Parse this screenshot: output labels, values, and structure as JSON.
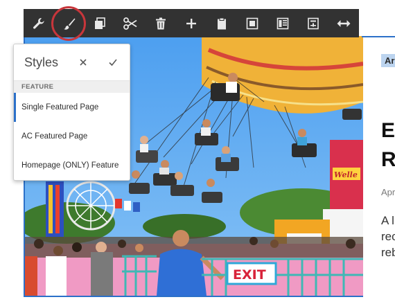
{
  "toolbar": {
    "buttons": [
      {
        "id": "configure",
        "icon": "wrench-icon"
      },
      {
        "id": "styles",
        "icon": "paintbrush-icon",
        "highlighted": true
      },
      {
        "id": "copy",
        "icon": "copy-icon"
      },
      {
        "id": "cut",
        "icon": "scissors-icon"
      },
      {
        "id": "delete",
        "icon": "trash-icon"
      },
      {
        "id": "insert",
        "icon": "plus-icon"
      },
      {
        "id": "paste",
        "icon": "clipboard-icon"
      },
      {
        "id": "group",
        "icon": "group-icon"
      },
      {
        "id": "layout",
        "icon": "layout-icon"
      },
      {
        "id": "convert",
        "icon": "template-icon"
      },
      {
        "id": "resize",
        "icon": "resize-icon"
      }
    ],
    "highlight_color": "#c8363b",
    "background": "#323232"
  },
  "styles_popover": {
    "title": "Styles",
    "section_label": "FEATURE",
    "items": [
      {
        "label": "Single Featured Page",
        "selected": true
      },
      {
        "label": "AC Featured Page",
        "selected": false
      },
      {
        "label": "Homepage (ONLY) Feature",
        "selected": false
      }
    ],
    "accent_color": "#2b70c9"
  },
  "article": {
    "tag": "Ar",
    "heading": "E\nR",
    "date": "Apr",
    "excerpt": "A l\nrec\nreb"
  },
  "photo": {
    "exit_sign": "EXIT",
    "booth_sign": "Welle"
  }
}
